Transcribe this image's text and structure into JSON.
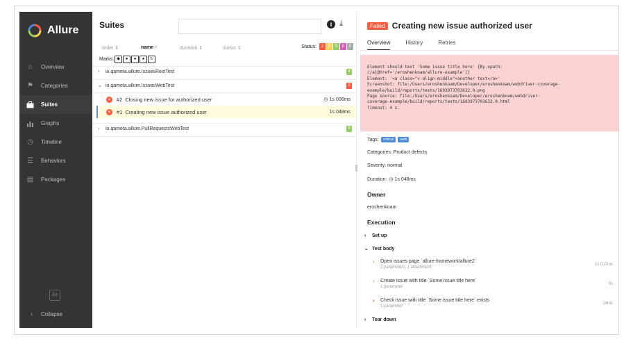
{
  "app": {
    "name": "Allure"
  },
  "sidebar": {
    "items": [
      {
        "label": "Overview",
        "icon": "home-icon",
        "active": false
      },
      {
        "label": "Categories",
        "icon": "flag-icon",
        "active": false
      },
      {
        "label": "Suites",
        "icon": "briefcase-icon",
        "active": true
      },
      {
        "label": "Graphs",
        "icon": "bar-chart-icon",
        "active": false
      },
      {
        "label": "Timeline",
        "icon": "clock-icon",
        "active": false
      },
      {
        "label": "Behaviors",
        "icon": "list-icon",
        "active": false
      },
      {
        "label": "Packages",
        "icon": "package-icon",
        "active": false
      }
    ],
    "lang": "En",
    "collapse_label": "Collapse"
  },
  "suites": {
    "title": "Suites",
    "sort": [
      {
        "label": "order",
        "active": false
      },
      {
        "label": "name",
        "active": true
      },
      {
        "label": "duration",
        "active": false
      },
      {
        "label": "status",
        "active": false
      }
    ],
    "status_label": "Status:",
    "status_counts": [
      {
        "value": "2",
        "color": "#fd5a3e"
      },
      {
        "value": "0",
        "color": "#ffd050"
      },
      {
        "value": "5",
        "color": "#97cc64"
      },
      {
        "value": "0",
        "color": "#d35ebe"
      },
      {
        "value": "0",
        "color": "#aaaaaa"
      }
    ],
    "marks_label": "Marks:",
    "groups": [
      {
        "name": "io.qameta.allure.IssuesRestTest",
        "badge": "4",
        "badge_color": "#97cc64",
        "expanded": false
      },
      {
        "name": "io.qameta.allure.IssuesWebTest",
        "badge": "2",
        "badge_color": "#fd5a3e",
        "expanded": true
      },
      {
        "name": "io.qameta.allure.PullRequestsWebTest",
        "badge": "3",
        "badge_color": "#97cc64",
        "expanded": false
      }
    ],
    "tests": [
      {
        "num": "#2",
        "name": "Closing new issue for authorized user",
        "duration": "1s 006ms",
        "selected": false
      },
      {
        "num": "#1",
        "name": "Creating new issue authorized user",
        "duration": "1s 048ms",
        "selected": true
      }
    ]
  },
  "detail": {
    "status": "Failed",
    "title": "Creating new issue authorized user",
    "tabs": [
      "Overview",
      "History",
      "Retries"
    ],
    "error": "Element should text 'Some issue title here' {By.xpath:\n//a[@href='/eroshenkoam/allure-example']}\nElement: '<a class=\"v-align-middle\">another text</a>'\nScreenshot: file:/Users/eroshenkoam/Developer/eroshenkoam/webdriver-coverage-\nexample/build/reports/tests/1603973703632.0.png\nPage source: file:/Users/eroshenkoam/Developer/eroshenkoam/webdriver-\ncoverage-example/build/reports/tests/1603973703632.0.html\nTimeout: 4 s.",
    "tags_label": "Tags:",
    "tags": [
      "critical",
      "web"
    ],
    "categories": "Categories: Product defects",
    "severity": "Severity: normal",
    "duration_label": "Duration:",
    "duration": "1s 048ms",
    "owner_title": "Owner",
    "owner": "eroshenkoam",
    "execution_title": "Execution",
    "setup_label": "Set up",
    "testbody_label": "Test body",
    "steps": [
      {
        "name": "Open issues page `allure-framework/allure2`",
        "sub": "2 parameters, 1 attachment",
        "duration": "1s 017ms",
        "status": "passed"
      },
      {
        "name": "Create issue with title `Some issue title here`",
        "sub": "1 parameter",
        "duration": "0s",
        "status": "passed"
      },
      {
        "name": "Check issue with title `Some issue title here` exists",
        "sub": "1 parameter",
        "duration": "14ms",
        "status": "failed"
      }
    ],
    "teardown_label": "Tear down"
  },
  "colors": {
    "sidebar": "#343434",
    "failed": "#fd5a3e",
    "passed": "#97cc64",
    "selected_row": "#fffbdc",
    "error_bg": "#fbd3d3"
  }
}
